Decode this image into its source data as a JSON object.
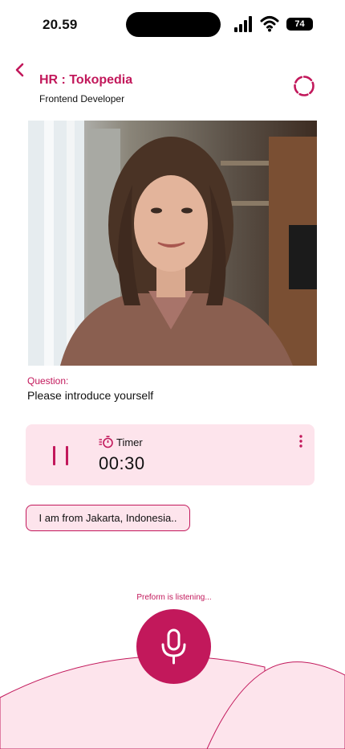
{
  "status_bar": {
    "time": "20.59",
    "battery": "74"
  },
  "header": {
    "title": "HR : Tokopedia",
    "role": "Frontend Developer"
  },
  "question": {
    "label": "Question:",
    "text": "Please introduce yourself"
  },
  "timer": {
    "label": "Timer",
    "value": "00:30"
  },
  "transcript": {
    "text": "I am from Jakarta, Indonesia.."
  },
  "listening": {
    "text": "Preform is listening..."
  },
  "colors": {
    "accent": "#c2185b",
    "accent_soft": "#fde4ec"
  }
}
